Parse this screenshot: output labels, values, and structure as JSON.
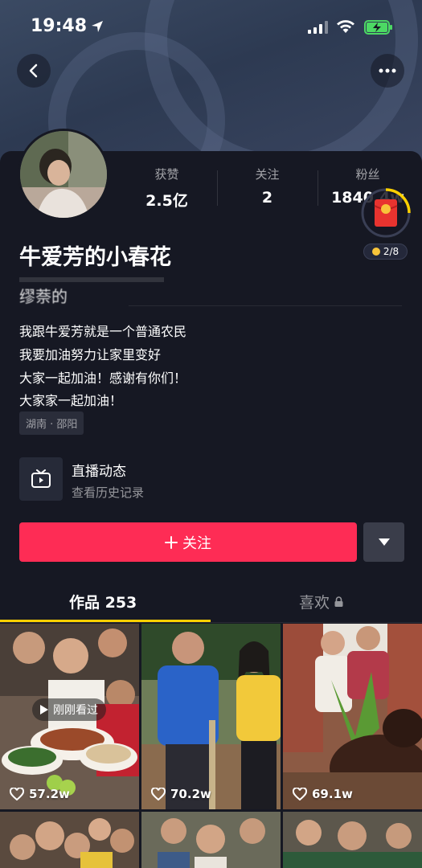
{
  "status_bar": {
    "time": "19:48"
  },
  "profile": {
    "nickname": "牛爱芳的小春花",
    "garbled_line": "缪萘的",
    "location": "湖南 · 邵阳"
  },
  "stats": [
    {
      "label": "获赞",
      "value": "2.5亿"
    },
    {
      "label": "关注",
      "value": "2"
    },
    {
      "label": "粉丝",
      "value": "1840.4w"
    }
  ],
  "red_packet": {
    "progress": "2/8"
  },
  "bio": [
    "我跟牛爱芳就是一个普通农民",
    "我要加油努力让家里变好",
    "大家一起加油！感谢有你们！",
    "大家家一起加油！"
  ],
  "live": {
    "title": "直播动态",
    "subtitle": "查看历史记录"
  },
  "actions": {
    "follow_label": "关注"
  },
  "tabs": {
    "works_label": "作品 253",
    "likes_label": "喜欢"
  },
  "grid": [
    {
      "likes": "57.2w",
      "badge": "刚刚看过"
    },
    {
      "likes": "70.2w"
    },
    {
      "likes": "69.1w"
    }
  ],
  "colors": {
    "accent": "#fe2c55",
    "tab_indicator": "#fcd000",
    "background": "#161823"
  }
}
